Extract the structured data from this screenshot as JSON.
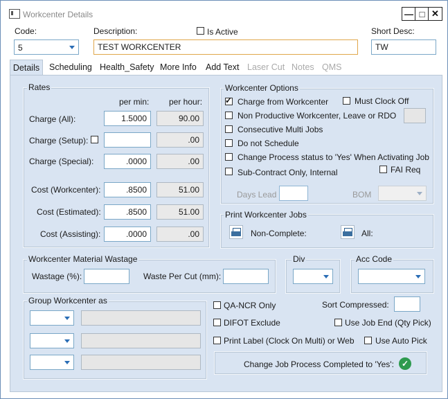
{
  "window": {
    "title": "Workcenter Details"
  },
  "header": {
    "code_label": "Code:",
    "code_value": "5",
    "description_label": "Description:",
    "description_value": "TEST WORKCENTER",
    "is_active_label": "Is Active",
    "short_desc_label": "Short Desc:",
    "short_desc_value": "TW"
  },
  "tabs": [
    {
      "label": "Details"
    },
    {
      "label": "Scheduling"
    },
    {
      "label": "Health_Safety"
    },
    {
      "label": "More Info"
    },
    {
      "label": "Add Text"
    },
    {
      "label": "Laser Cut"
    },
    {
      "label": "Notes"
    },
    {
      "label": "QMS"
    }
  ],
  "rates": {
    "title": "Rates",
    "per_min": "per min:",
    "per_hour": "per hour:",
    "rows": [
      {
        "label": "Charge (All):",
        "per_min": "1.5000",
        "per_hour": "90.00"
      },
      {
        "label": "Charge (Setup):",
        "per_min": "",
        "per_hour": ".00"
      },
      {
        "label": "Charge (Special):",
        "per_min": ".0000",
        "per_hour": ".00"
      },
      {
        "label": "Cost (Workcenter):",
        "per_min": ".8500",
        "per_hour": "51.00"
      },
      {
        "label": "Cost (Estimated):",
        "per_min": ".8500",
        "per_hour": "51.00"
      },
      {
        "label": "Cost (Assisting):",
        "per_min": ".0000",
        "per_hour": ".00"
      }
    ]
  },
  "options": {
    "title": "Workcenter Options",
    "charge_from_workcenter": "Charge from Workcenter",
    "must_clock_off": "Must Clock Off",
    "non_productive": "Non Productive Workcenter, Leave or RDO",
    "consecutive_multi_jobs": "Consecutive Multi Jobs",
    "do_not_schedule": "Do not Schedule",
    "change_process_status": "Change Process status to 'Yes' When Activating Job",
    "sub_contract": "Sub-Contract Only, Internal",
    "fai_req": "FAI  Req",
    "days_lead": "Days Lead",
    "bom": "BOM"
  },
  "print_jobs": {
    "title": "Print Workcenter Jobs",
    "non_complete": "Non-Complete:",
    "all": "All:"
  },
  "wastage": {
    "title": "Workcenter Material Wastage",
    "wastage_label": "Wastage (%):",
    "waste_per_cut_label": "Waste Per Cut (mm):"
  },
  "div": {
    "title": "Div"
  },
  "acc_code": {
    "title": "Acc Code"
  },
  "group_workcenter": {
    "title": "Group Workcenter as"
  },
  "misc": {
    "qa_ncr_only": "QA-NCR Only",
    "difot_exclude": "DIFOT Exclude",
    "print_label": "Print Label (Clock On Multi) or Web",
    "sort_compressed": "Sort Compressed:",
    "use_job_end": "Use Job End (Qty Pick)",
    "use_auto_pick": "Use Auto Pick",
    "change_job_process": "Change Job Process Completed to 'Yes':"
  },
  "colors": {
    "panel": "#d9e4f2",
    "accent": "#2a6db5",
    "ok": "#2e9a4e"
  }
}
